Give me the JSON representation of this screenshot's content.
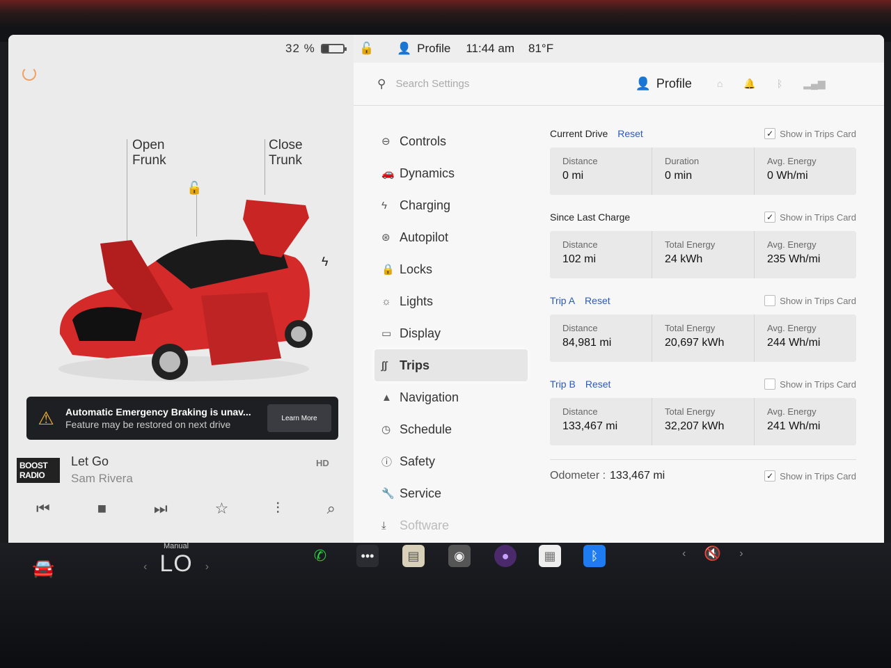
{
  "status_bar": {
    "battery_percent": "32 %",
    "battery_level": 0.32,
    "profile_label": "Profile",
    "time": "11:44 am",
    "temperature": "81°F"
  },
  "vehicle_panel": {
    "frunk_label_1": "Open",
    "frunk_label_2": "Frunk",
    "trunk_label_1": "Close",
    "trunk_label_2": "Trunk",
    "car_color": "#d42a2a"
  },
  "alert": {
    "title": "Automatic Emergency Braking is unav...",
    "subtitle": "Feature may be restored on next drive",
    "button": "Learn More"
  },
  "media": {
    "station_logo_line1": "BOOST",
    "station_logo_line2": "RADIO",
    "title": "Let Go",
    "artist": "Sam Rivera",
    "hd_label": "HD"
  },
  "settings": {
    "search_placeholder": "Search Settings",
    "profile_label": "Profile",
    "menu": [
      {
        "label": "Controls",
        "icon": "toggle-icon"
      },
      {
        "label": "Dynamics",
        "icon": "car-icon"
      },
      {
        "label": "Charging",
        "icon": "bolt-icon"
      },
      {
        "label": "Autopilot",
        "icon": "steering-wheel-icon"
      },
      {
        "label": "Locks",
        "icon": "lock-icon"
      },
      {
        "label": "Lights",
        "icon": "sun-icon"
      },
      {
        "label": "Display",
        "icon": "display-icon"
      },
      {
        "label": "Trips",
        "icon": "trips-icon"
      },
      {
        "label": "Navigation",
        "icon": "navigation-arrow-icon"
      },
      {
        "label": "Schedule",
        "icon": "clock-icon"
      },
      {
        "label": "Safety",
        "icon": "info-circle-icon"
      },
      {
        "label": "Service",
        "icon": "wrench-icon"
      },
      {
        "label": "Software",
        "icon": "download-icon"
      }
    ],
    "active_menu": "Trips"
  },
  "trips": {
    "show_label": "Show in Trips Card",
    "reset_label": "Reset",
    "sections": [
      {
        "title": "Current Drive",
        "has_reset": true,
        "show_checked": true,
        "stats": [
          {
            "label": "Distance",
            "value": "0 mi"
          },
          {
            "label": "Duration",
            "value": "0 min"
          },
          {
            "label": "Avg. Energy",
            "value": "0 Wh/mi"
          }
        ]
      },
      {
        "title": "Since Last Charge",
        "has_reset": false,
        "show_checked": true,
        "stats": [
          {
            "label": "Distance",
            "value": "102 mi"
          },
          {
            "label": "Total Energy",
            "value": "24 kWh"
          },
          {
            "label": "Avg. Energy",
            "value": "235 Wh/mi"
          }
        ]
      },
      {
        "title": "Trip A",
        "has_reset": true,
        "show_checked": false,
        "stats": [
          {
            "label": "Distance",
            "value": "84,981 mi"
          },
          {
            "label": "Total Energy",
            "value": "20,697 kWh"
          },
          {
            "label": "Avg. Energy",
            "value": "244 Wh/mi"
          }
        ]
      },
      {
        "title": "Trip B",
        "has_reset": true,
        "show_checked": false,
        "stats": [
          {
            "label": "Distance",
            "value": "133,467 mi"
          },
          {
            "label": "Total Energy",
            "value": "32,207 kWh"
          },
          {
            "label": "Avg. Energy",
            "value": "241 Wh/mi"
          }
        ]
      }
    ],
    "odometer_label": "Odometer :",
    "odometer_value": "133,467 mi",
    "odometer_show_checked": true
  },
  "taskbar": {
    "climate_mode": "Manual",
    "climate_temp": "LO",
    "apps": [
      "phone-icon",
      "more-apps-icon",
      "notepad-icon",
      "camera-icon",
      "tidal-icon",
      "calendar-icon",
      "bluetooth-icon"
    ],
    "volume_state": "muted",
    "accent_colors": {
      "phone": "#2ecc40",
      "bluetooth": "#1e7bf0",
      "camera_badge": "#e53935"
    }
  }
}
